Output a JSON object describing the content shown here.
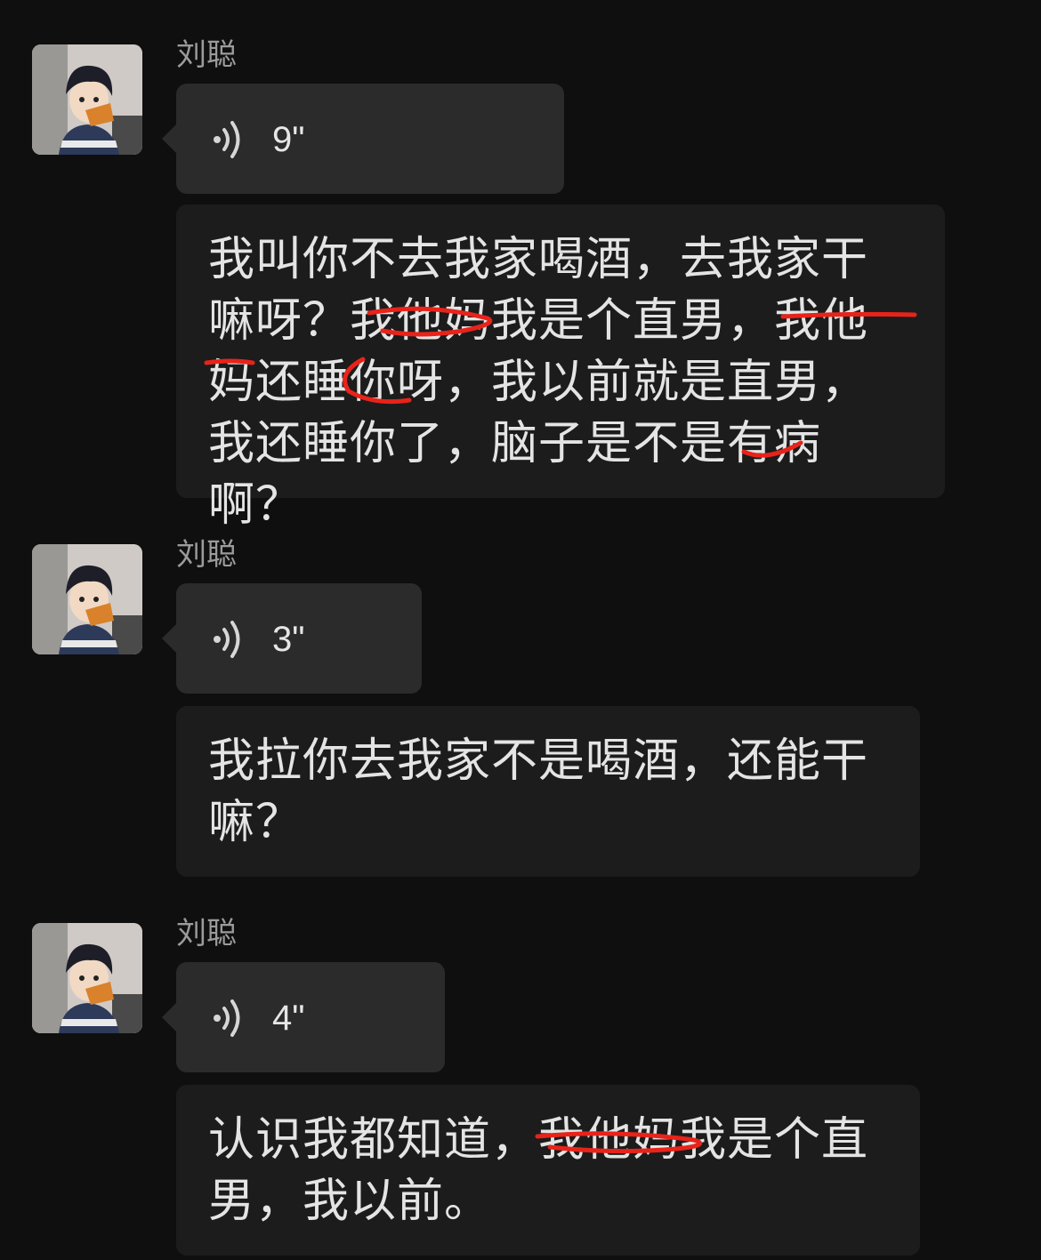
{
  "messages": [
    {
      "sender": "刘聪",
      "voice_duration": "9\"",
      "transcript": "我叫你不去我家喝酒，去我家干嘛呀？我他妈我是个直男，我他妈还睡你呀，我以前就是直男，我还睡你了，脑子是不是有病啊？"
    },
    {
      "sender": "刘聪",
      "voice_duration": "3\"",
      "transcript": "我拉你去我家不是喝酒，还能干嘛？"
    },
    {
      "sender": "刘聪",
      "voice_duration": "4\"",
      "transcript": "认识我都知道，我他妈我是个直男，我以前。"
    }
  ],
  "icons": {
    "voice": "voice-wave-icon",
    "avatar": "anime-boy-avatar"
  },
  "colors": {
    "background": "#0f0f0f",
    "voice_bubble": "#2b2b2b",
    "text_bubble": "#1c1c1c",
    "sender_name": "#9b9b9b",
    "redaction_strike": "#e8231a"
  }
}
